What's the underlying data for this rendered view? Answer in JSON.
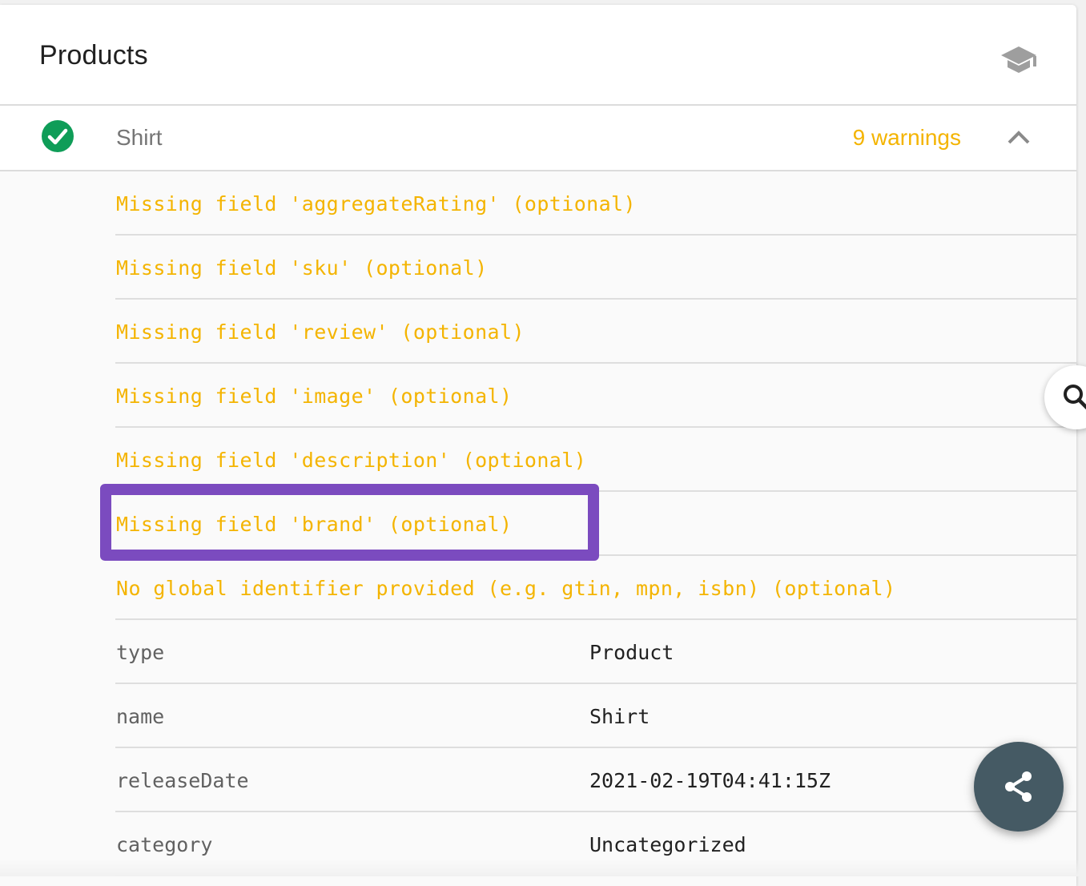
{
  "card": {
    "title": "Products",
    "header_icon": "graduation-cap-icon"
  },
  "item": {
    "status_icon": "check-circle-icon",
    "status_color": "#0f9d58",
    "name": "Shirt",
    "warnings_label": "9 warnings",
    "expand_icon": "chevron-up-icon"
  },
  "warnings": [
    "Missing field 'aggregateRating' (optional)",
    "Missing field 'sku' (optional)",
    "Missing field 'review' (optional)",
    "Missing field 'image' (optional)",
    "Missing field 'description' (optional)",
    "Missing field 'brand' (optional)",
    "No global identifier provided (e.g. gtin, mpn, isbn) (optional)"
  ],
  "properties": [
    {
      "key": "type",
      "value": "Product"
    },
    {
      "key": "name",
      "value": "Shirt"
    },
    {
      "key": "releaseDate",
      "value": "2021-02-19T04:41:15Z"
    },
    {
      "key": "category",
      "value": "Uncategorized"
    }
  ],
  "highlight": {
    "target": "Missing field 'brand' (optional)",
    "color": "#7b4bbf"
  },
  "colors": {
    "warning": "#f4b400",
    "fab": "#455a64"
  },
  "fabs": {
    "search_icon": "search-icon",
    "share_icon": "share-icon"
  }
}
